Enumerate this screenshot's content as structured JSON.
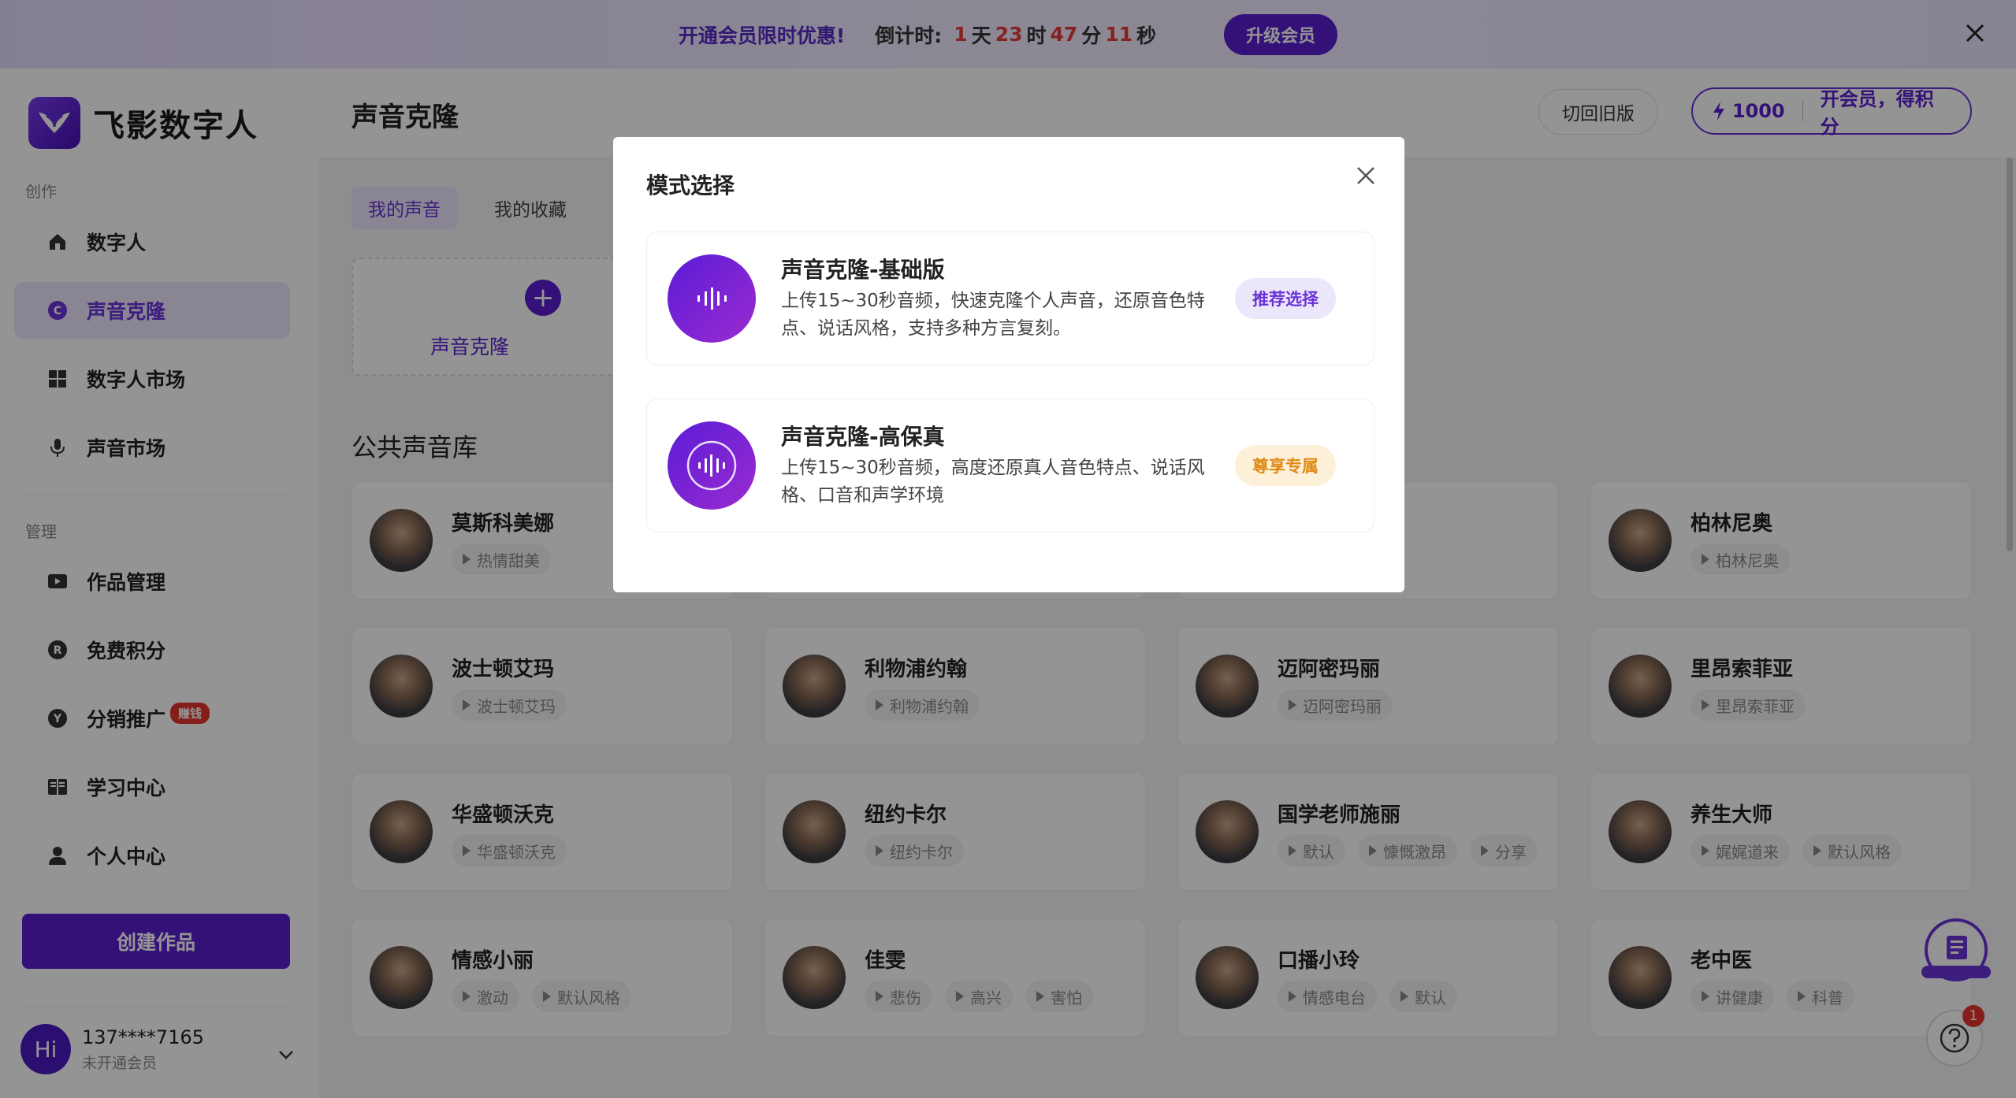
{
  "banner": {
    "promo": "开通会员限时优惠!",
    "countdown_label": "倒计时:",
    "days": "1",
    "days_unit": "天",
    "hours": "23",
    "hours_unit": "时",
    "minutes": "47",
    "minutes_unit": "分",
    "seconds": "11",
    "seconds_unit": "秒",
    "upgrade": "升级会员"
  },
  "sidebar": {
    "brand": "飞影数字人",
    "section_create": "创作",
    "section_manage": "管理",
    "items": [
      {
        "label": "数字人",
        "icon": "home-icon"
      },
      {
        "label": "声音克隆",
        "icon": "c-icon"
      },
      {
        "label": "数字人市场",
        "icon": "grid-icon"
      },
      {
        "label": "声音市场",
        "icon": "mic-icon"
      },
      {
        "label": "作品管理",
        "icon": "video-icon"
      },
      {
        "label": "免费积分",
        "icon": "r-icon"
      },
      {
        "label": "分销推广",
        "icon": "yen-icon",
        "badge": "赚钱"
      },
      {
        "label": "学习中心",
        "icon": "book-icon"
      },
      {
        "label": "个人中心",
        "icon": "user-icon"
      }
    ],
    "create": "创建作品",
    "user": {
      "avatar": "Hi",
      "phone": "137****7165",
      "status": "未开通会员"
    }
  },
  "header": {
    "title": "声音克隆",
    "old_version": "切回旧版",
    "points": "1000",
    "points_cta": "开会员，得积分"
  },
  "tabs": [
    "我的声音",
    "我的收藏"
  ],
  "add_card_label": "声音克隆",
  "library_title": "公共声音库",
  "voices": [
    {
      "name": "莫斯科美娜",
      "tags": [
        "热情甜美"
      ]
    },
    {
      "name": "",
      "tags": []
    },
    {
      "name": "",
      "tags": []
    },
    {
      "name": "柏林尼奥",
      "tags": [
        "柏林尼奥"
      ]
    },
    {
      "name": "波士顿艾玛",
      "tags": [
        "波士顿艾玛"
      ]
    },
    {
      "name": "利物浦约翰",
      "tags": [
        "利物浦约翰"
      ]
    },
    {
      "name": "迈阿密玛丽",
      "tags": [
        "迈阿密玛丽"
      ]
    },
    {
      "name": "里昂索菲亚",
      "tags": [
        "里昂索菲亚"
      ]
    },
    {
      "name": "华盛顿沃克",
      "tags": [
        "华盛顿沃克"
      ]
    },
    {
      "name": "纽约卡尔",
      "tags": [
        "纽约卡尔"
      ]
    },
    {
      "name": "国学老师施丽",
      "tags": [
        "默认",
        "慷慨激昂",
        "分享"
      ]
    },
    {
      "name": "养生大师",
      "tags": [
        "娓娓道来",
        "默认风格"
      ]
    },
    {
      "name": "情感小丽",
      "tags": [
        "激动",
        "默认风格"
      ]
    },
    {
      "name": "佳雯",
      "tags": [
        "悲伤",
        "高兴",
        "害怕"
      ]
    },
    {
      "name": "口播小玲",
      "tags": [
        "情感电台",
        "默认"
      ]
    },
    {
      "name": "老中医",
      "tags": [
        "讲健康",
        "科普"
      ]
    }
  ],
  "modal": {
    "title": "模式选择",
    "options": [
      {
        "title": "声音克隆-基础版",
        "desc": "上传15~30秒音频，快速克隆个人声音，还原音色特点、说话风格，支持多种方言复刻。",
        "pill": "推荐选择"
      },
      {
        "title": "声音克隆-高保真",
        "desc": "上传15~30秒音频，高度还原真人音色特点、说话风格、口音和声学环境",
        "pill": "尊享专属"
      }
    ]
  },
  "help_badge": "1",
  "colors": {
    "accent": "#5b1ecf",
    "active_bg": "#ece6fb",
    "countdown": "#e53b3b",
    "vip": "#e08a16"
  }
}
